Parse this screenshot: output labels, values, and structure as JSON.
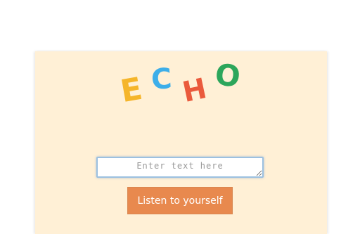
{
  "logo": {
    "letters": [
      {
        "char": "E",
        "color": "#f5b52a"
      },
      {
        "char": "C",
        "color": "#3daee9"
      },
      {
        "char": "H",
        "color": "#ea5a3c"
      },
      {
        "char": "O",
        "color": "#2ca65b"
      }
    ]
  },
  "input": {
    "placeholder": "Enter text here",
    "value": ""
  },
  "button": {
    "label": "Listen to yourself"
  },
  "colors": {
    "card_background": "#fff0d6",
    "button_background": "#e8894e",
    "input_border": "#9cc0e0"
  }
}
